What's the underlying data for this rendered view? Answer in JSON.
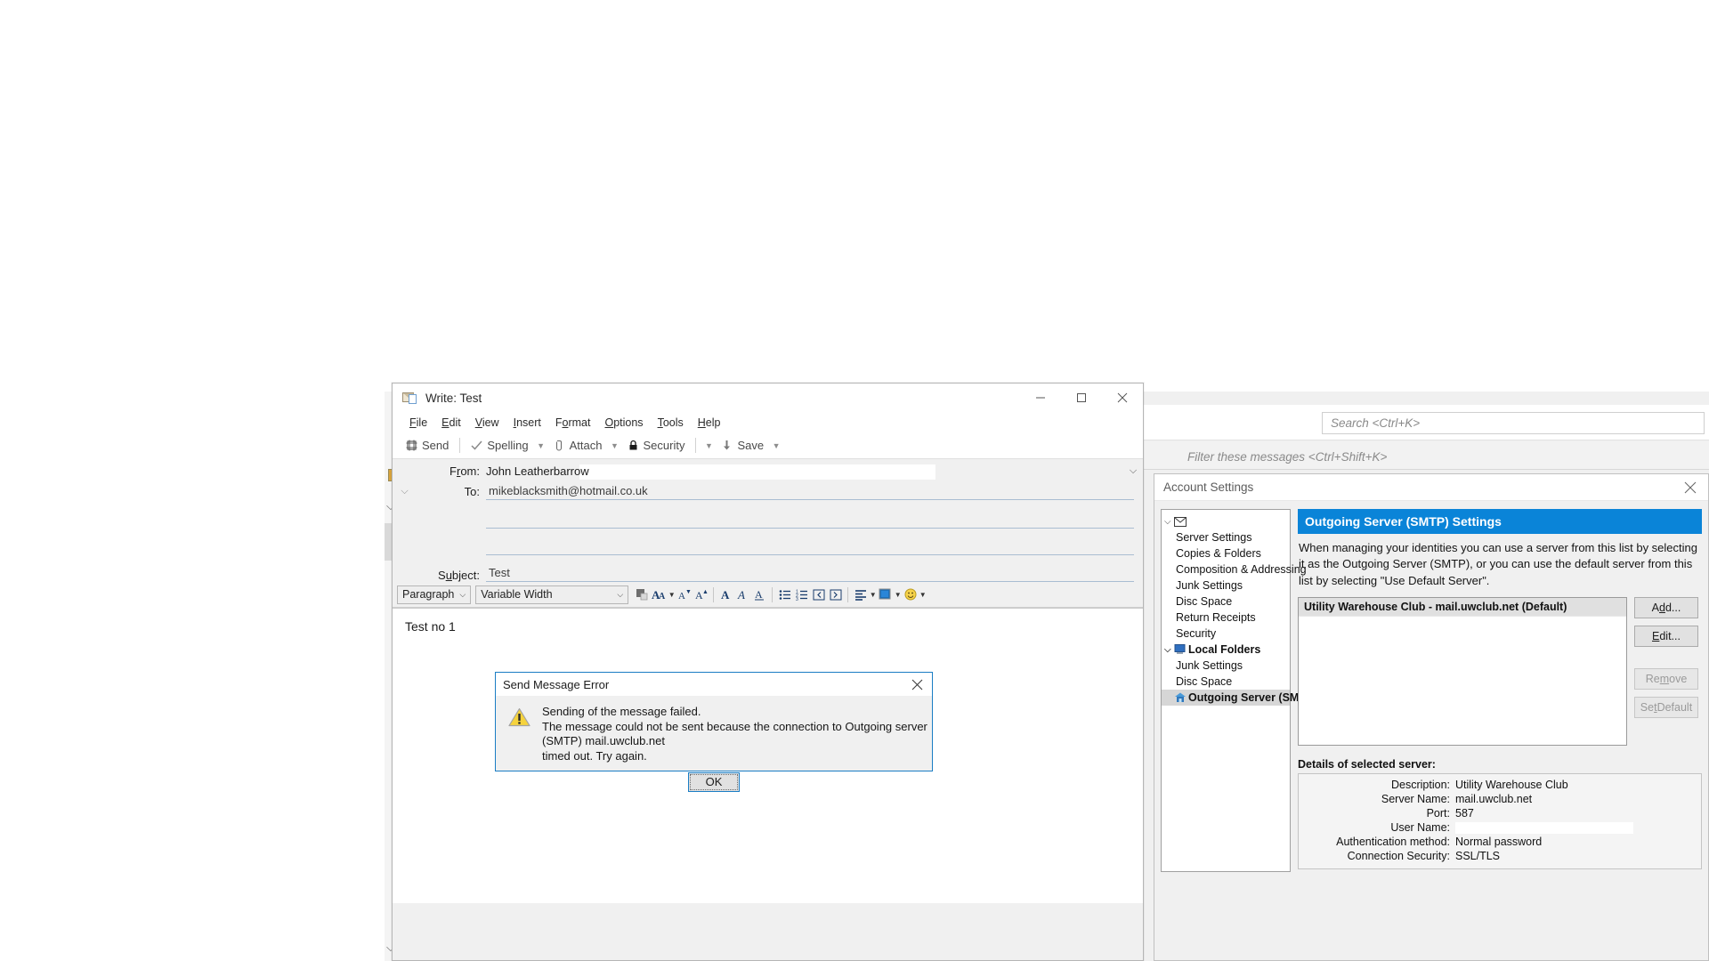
{
  "background": {
    "search_placeholder": "Search <Ctrl+K>",
    "filter_placeholder": "Filter these messages <Ctrl+Shift+K>"
  },
  "write_window": {
    "title": "Write: Test",
    "window_controls": {
      "minimize": "minimize-icon",
      "maximize": "maximize-icon",
      "close": "close-icon"
    },
    "menus": [
      {
        "label": "File",
        "accel": "F"
      },
      {
        "label": "Edit",
        "accel": "E"
      },
      {
        "label": "View",
        "accel": "V"
      },
      {
        "label": "Insert",
        "accel": "I"
      },
      {
        "label": "Format",
        "accel": "o"
      },
      {
        "label": "Options",
        "accel": "O"
      },
      {
        "label": "Tools",
        "accel": "T"
      },
      {
        "label": "Help",
        "accel": "H"
      }
    ],
    "toolbar": {
      "send": "Send",
      "spelling": "Spelling",
      "attach": "Attach",
      "security": "Security",
      "save": "Save"
    },
    "headers": {
      "from_label": "From:",
      "from_value": "John Leatherbarrow",
      "to_label": "To:",
      "to_value": "mikeblacksmith@hotmail.co.uk",
      "subject_label": "Subject:",
      "subject_value": "Test"
    },
    "format_toolbar": {
      "paragraph": "Paragraph",
      "font": "Variable Width"
    },
    "body_text": "Test no 1"
  },
  "error_dialog": {
    "title": "Send Message Error",
    "line1": "Sending of the message failed.",
    "line2": "The message could not be sent because the connection to Outgoing server (SMTP) mail.uwclub.net",
    "line3": "timed out. Try again.",
    "ok_label": "OK"
  },
  "account_settings": {
    "title": "Account Settings",
    "tree": [
      {
        "label": "",
        "type": "account-root",
        "icon": "envelope-icon",
        "expanded": true,
        "bold": false
      },
      {
        "label": "Server Settings",
        "type": "child",
        "bold": false
      },
      {
        "label": "Copies & Folders",
        "type": "child",
        "bold": false
      },
      {
        "label": "Composition & Addressing",
        "type": "child",
        "bold": false
      },
      {
        "label": "Junk Settings",
        "type": "child",
        "bold": false
      },
      {
        "label": "Disc Space",
        "type": "child",
        "bold": false
      },
      {
        "label": "Return Receipts",
        "type": "child",
        "bold": false
      },
      {
        "label": "Security",
        "type": "child",
        "bold": false
      },
      {
        "label": "Local Folders",
        "type": "folder-root",
        "icon": "local-folders-icon",
        "expanded": true,
        "bold": true
      },
      {
        "label": "Junk Settings",
        "type": "child",
        "bold": false
      },
      {
        "label": "Disc Space",
        "type": "child",
        "bold": false
      },
      {
        "label": "Outgoing Server (SMTP)",
        "type": "smtp",
        "icon": "smtp-icon",
        "selected": true,
        "bold": true
      }
    ],
    "pane": {
      "header": "Outgoing Server (SMTP) Settings",
      "description": "When managing your identities you can use a server from this list by selecting it as the Outgoing Server (SMTP), or you can use the default server from this list by selecting \"Use Default Server\".",
      "servers": [
        "Utility Warehouse Club - mail.uwclub.net (Default)"
      ],
      "buttons": [
        {
          "label": "Add...",
          "accel": "d",
          "enabled": true
        },
        {
          "label": "Edit...",
          "accel": "E",
          "enabled": true
        },
        {
          "label": "Remove",
          "accel": "m",
          "enabled": false
        },
        {
          "label": "Set Default",
          "accel": "t",
          "enabled": false
        }
      ],
      "details_title": "Details of selected server:",
      "details": [
        {
          "label": "Description:",
          "value": "Utility Warehouse Club",
          "is_input": false
        },
        {
          "label": "Server Name:",
          "value": "mail.uwclub.net",
          "is_input": false
        },
        {
          "label": "Port:",
          "value": "587",
          "is_input": false
        },
        {
          "label": "User Name:",
          "value": "",
          "is_input": true
        },
        {
          "label": "Authentication method:",
          "value": "Normal password",
          "is_input": false
        },
        {
          "label": "Connection Security:",
          "value": "SSL/TLS",
          "is_input": false
        }
      ]
    }
  },
  "colors": {
    "accent_blue": "#0a84d8",
    "dialog_border_blue": "#1a7dc4",
    "chrome_gray": "#f0f0f0"
  }
}
